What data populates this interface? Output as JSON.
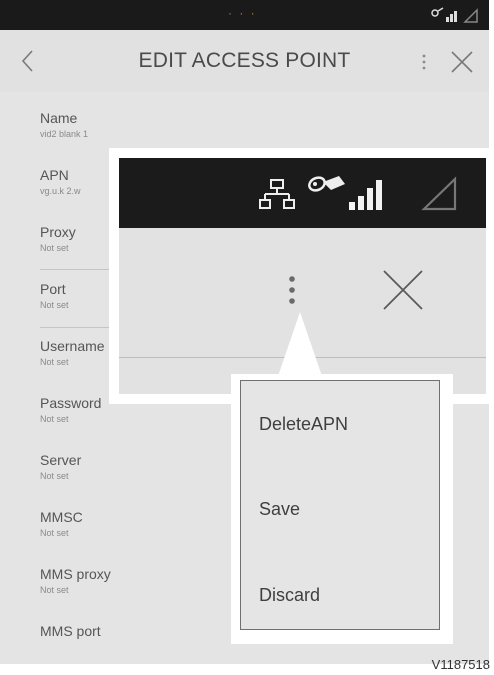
{
  "toolbar": {
    "title": "EDIT ACCESS POINT"
  },
  "fields": [
    {
      "label": "Name",
      "value": "vid2 blank 1"
    },
    {
      "label": "APN",
      "value": "vg.u.k 2.w"
    },
    {
      "label": "Proxy",
      "value": "Not set"
    },
    {
      "label": "Port",
      "value": "Not set"
    },
    {
      "label": "Username",
      "value": "Not set"
    },
    {
      "label": "Password",
      "value": "Not set"
    },
    {
      "label": "Server",
      "value": "Not set"
    },
    {
      "label": "MMSC",
      "value": "Not set"
    },
    {
      "label": "MMS proxy",
      "value": "Not set"
    },
    {
      "label": "MMS port",
      "value": ""
    }
  ],
  "menu": {
    "items": [
      "DeleteAPN",
      "Save",
      "Discard"
    ]
  },
  "figure_id": "V1187518",
  "colors": {
    "status_bar": "#1a1a1a",
    "screen_bg": "#e4e4e4",
    "menu_border": "#707070"
  }
}
